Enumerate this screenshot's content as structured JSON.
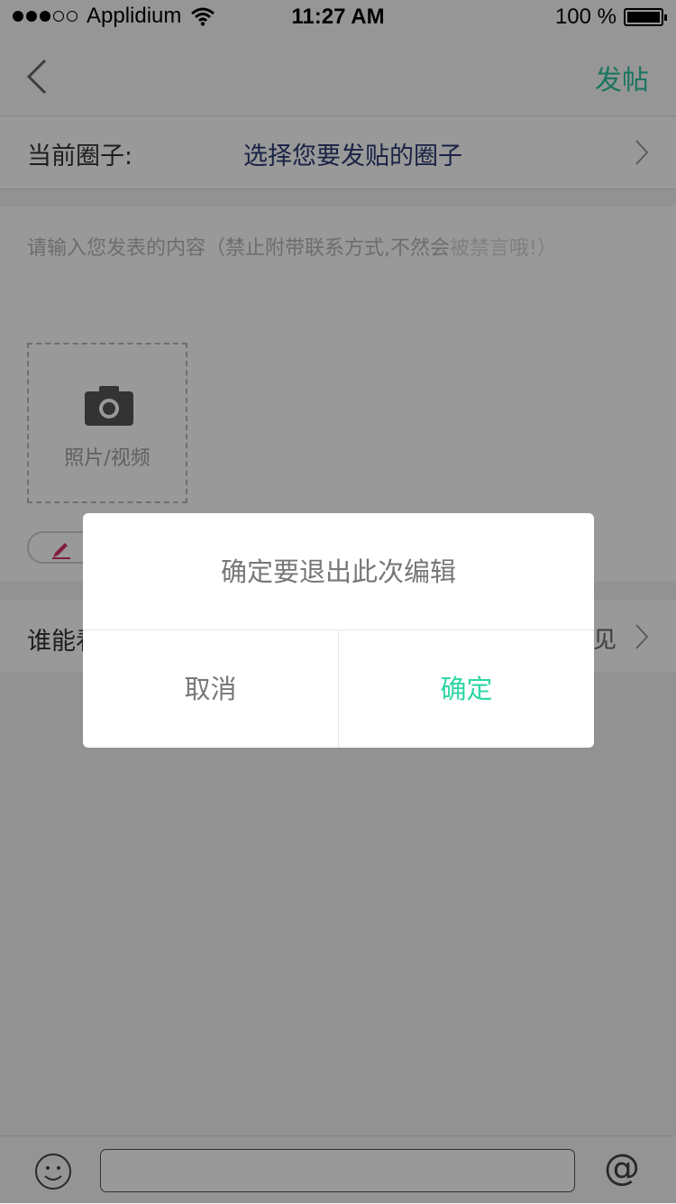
{
  "status_bar": {
    "carrier": "Applidium",
    "time": "11:27 AM",
    "battery": "100 %",
    "signal_bars_filled": 3,
    "signal_bars_total": 5
  },
  "nav": {
    "post_label": "发帖"
  },
  "circle": {
    "label": "当前圈子:",
    "value": "选择您要发贴的圈子"
  },
  "composer": {
    "placeholder_main": "请输入您发表的内容（禁止附带联系方式,不然会",
    "placeholder_tail": "被禁言哦!）",
    "photo_label": "照片/视频"
  },
  "visibility": {
    "label": "谁能看",
    "value": "见"
  },
  "dialog": {
    "message": "确定要退出此次编辑",
    "cancel": "取消",
    "confirm": "确定"
  },
  "colors": {
    "accent": "#2ec4a0",
    "confirm": "#2fd6a6",
    "circle_value": "#2a3a74",
    "pen": "#d8306a"
  },
  "icons": [
    "back-chevron-icon",
    "chevron-right-icon",
    "camera-icon",
    "pen-icon",
    "emoji-icon",
    "at-icon",
    "wifi-icon",
    "battery-icon"
  ]
}
